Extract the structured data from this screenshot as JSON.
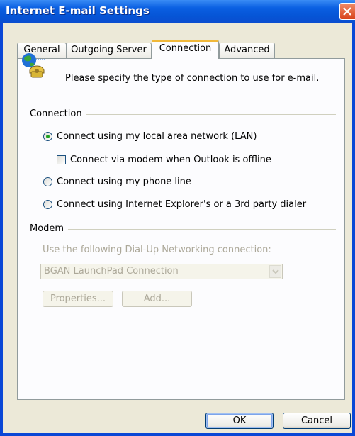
{
  "window": {
    "title": "Internet E-mail Settings"
  },
  "tabs": [
    {
      "label": "General",
      "active": false
    },
    {
      "label": "Outgoing Server",
      "active": false
    },
    {
      "label": "Connection",
      "active": true
    },
    {
      "label": "Advanced",
      "active": false
    }
  ],
  "intro": {
    "text": "Please specify the type of connection to use for e-mail.",
    "icon": "connection-globe-phone-icon"
  },
  "connection": {
    "label": "Connection",
    "options": {
      "lan": {
        "label": "Connect using my local area network (LAN)",
        "selected": true
      },
      "modem_offline": {
        "label": "Connect via modem when Outlook is offline",
        "checked": false
      },
      "phone": {
        "label": "Connect using my phone line",
        "selected": false
      },
      "ie_dialer": {
        "label": "Connect using Internet Explorer's or a 3rd party dialer",
        "selected": false
      }
    }
  },
  "modem": {
    "label": "Modem",
    "dialup_label": "Use the following Dial-Up Networking connection:",
    "dialup_value": "BGAN LaunchPad Connection",
    "properties_label": "Properties...",
    "add_label": "Add..."
  },
  "footer": {
    "ok_label": "OK",
    "cancel_label": "Cancel"
  },
  "colors": {
    "titlebar": "#0a5fe2",
    "dialog_bg": "#ece9d8",
    "active_tab_accent": "#f0b83a",
    "radio_dot": "#21a121"
  }
}
